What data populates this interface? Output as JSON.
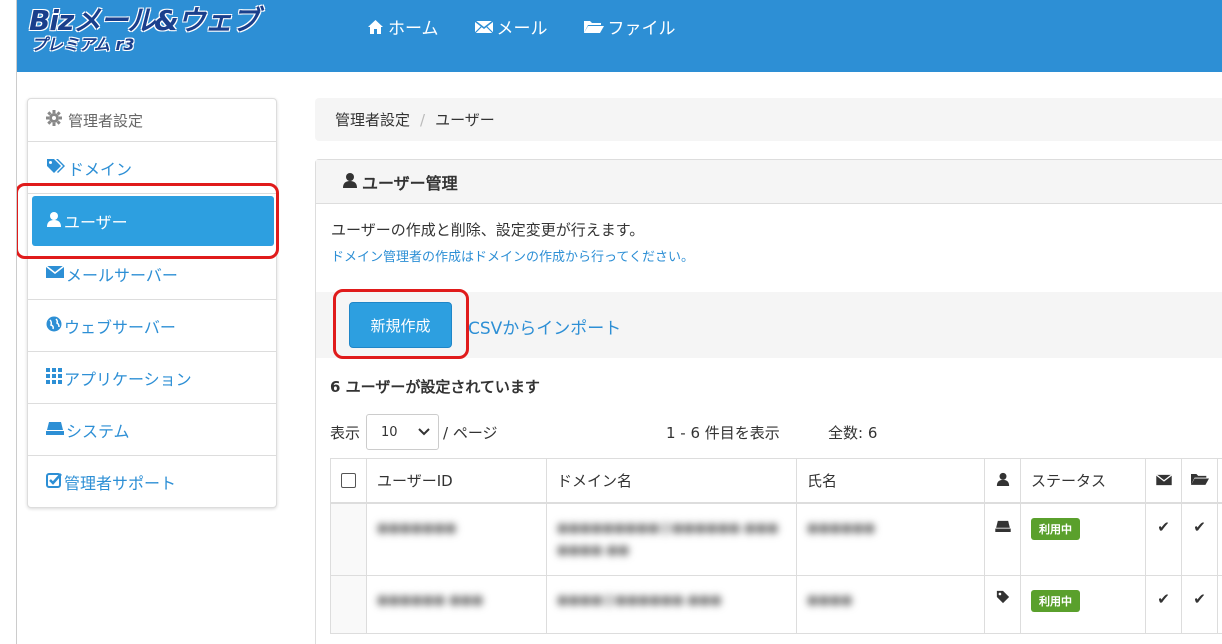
{
  "header": {
    "logo_main": "Bizメール&ウェブ",
    "logo_sub": "プレミアム r3",
    "nav": [
      {
        "label": "ホーム",
        "icon": "home-icon"
      },
      {
        "label": "メール",
        "icon": "envelope-icon"
      },
      {
        "label": "ファイル",
        "icon": "folder-icon"
      }
    ]
  },
  "sidebar": {
    "heading": "管理者設定",
    "items": [
      {
        "label": "ドメイン",
        "icon": "tags-icon"
      },
      {
        "label": "ユーザー",
        "icon": "user-icon",
        "active": true
      },
      {
        "label": "メールサーバー",
        "icon": "envelope-icon"
      },
      {
        "label": "ウェブサーバー",
        "icon": "globe-icon"
      },
      {
        "label": "アプリケーション",
        "icon": "grid-icon"
      },
      {
        "label": "システム",
        "icon": "drive-icon"
      },
      {
        "label": "管理者サポート",
        "icon": "check-square-icon"
      }
    ]
  },
  "breadcrumb": {
    "root": "管理者設定",
    "separator": "/",
    "current": "ユーザー"
  },
  "panel": {
    "title": "ユーザー管理",
    "description": "ユーザーの作成と削除、設定変更が行えます。",
    "note": "ドメイン管理者の作成はドメインの作成から行ってください。",
    "new_button": "新規作成",
    "csv_link": "CSVからインポート",
    "count_text": "6 ユーザーが設定されています",
    "per_page_label": "表示",
    "per_page_value": "10",
    "per_page_suffix": "/ ページ",
    "range_text": "1 - 6 件目を表示",
    "total_text": "全数: 6"
  },
  "table": {
    "headers": {
      "user_id": "ユーザーID",
      "domain": "ドメイン名",
      "name": "氏名",
      "status": "ステータス"
    },
    "rows": [
      {
        "user_id": "●●●●●●●",
        "domain": "●●●●●●●●●@●●●●●●.●●● ●●●●.●●",
        "name": "●●●●●●",
        "role_icon": "drive-icon",
        "status": "利用中",
        "mail": "✔",
        "file": "✔"
      },
      {
        "user_id": "●●●●●● ●●●",
        "domain": "●●●●@●●●●●●.●●●",
        "name": "●●●●",
        "role_icon": "tag-icon",
        "status": "利用中",
        "mail": "✔",
        "file": "✔"
      }
    ]
  },
  "colors": {
    "header_bg": "#2d8fd5",
    "accent": "#2d9fe0",
    "highlight": "#e01b1b",
    "status_green": "#5aa02c"
  }
}
